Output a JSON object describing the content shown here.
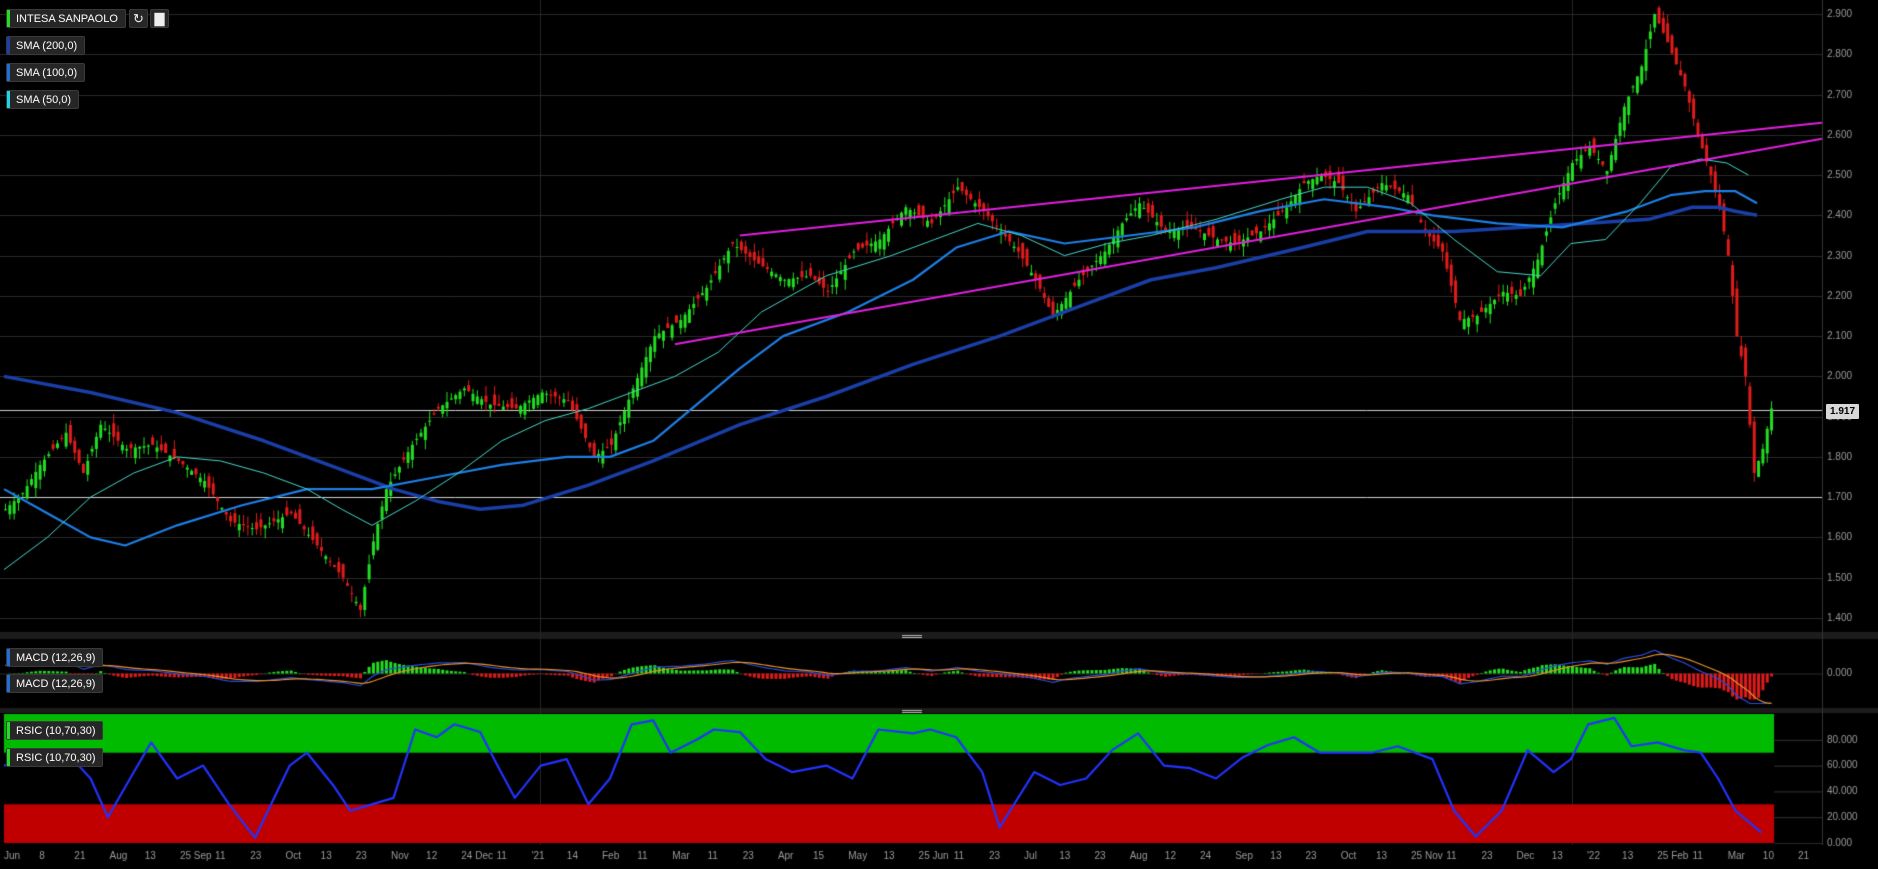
{
  "instrument": "INTESA SANPAOLO",
  "toolbar": {
    "refresh_icon": "refresh-icon",
    "settings_icon": "bar-chart-settings-icon"
  },
  "legends": {
    "sma200": "SMA (200,0)",
    "sma100": "SMA (100,0)",
    "sma50": "SMA (50,0)",
    "macd_a": "MACD (12,26,9)",
    "macd_b": "MACD (12,26,9)",
    "rsi_a": "RSIC (10,70,30)",
    "rsi_b": "RSIC (10,70,30)"
  },
  "colors": {
    "background": "#000000",
    "grid": "#2a2a2a",
    "candle_up": "#22dd22",
    "candle_down": "#e11b1b",
    "sma200": "#1a3fa8",
    "sma100": "#1e7fe6",
    "sma50": "#48d6c8",
    "trendline": "#e020e0",
    "macd_line": "#2a4bd6",
    "signal_line": "#e8902a",
    "rsi_line": "#2233ff",
    "rsi_overbought_zone": "#00bb00",
    "rsi_oversold_zone": "#c00000"
  },
  "chart_data": [
    {
      "type": "candlestick",
      "panel": "price",
      "title": "INTESA SANPAOLO",
      "last_price": 1.917,
      "last_price_label": "1.917",
      "ylim": [
        1.37,
        2.92
      ],
      "yticks": [
        "2.900",
        "2.800",
        "2.700",
        "2.600",
        "2.500",
        "2.400",
        "2.300",
        "2.200",
        "2.100",
        "2.000",
        "1.900",
        "1.800",
        "1.700",
        "1.600",
        "1.500",
        "1.400"
      ],
      "xticks": [
        "Jun",
        "8",
        "21",
        "Aug",
        "13",
        "25 Sep",
        "11",
        "23",
        "Oct",
        "13",
        "23",
        "Nov",
        "12",
        "24 Dec",
        "11",
        "'21",
        "14",
        "Feb",
        "11",
        "Mar",
        "11",
        "23",
        "Apr",
        "15",
        "May",
        "13",
        "25 Jun",
        "11",
        "23",
        "Jul",
        "13",
        "23",
        "Aug",
        "12",
        "24",
        "Sep",
        "13",
        "23",
        "Oct",
        "13",
        "25 Nov",
        "11",
        "23",
        "Dec",
        "13",
        "'22",
        "13",
        "25 Feb",
        "11",
        "Mar",
        "10",
        "21"
      ],
      "horizontal_lines": [
        1.917,
        1.7
      ],
      "price_path": [
        [
          0,
          1.67
        ],
        [
          4,
          1.71
        ],
        [
          8,
          1.78
        ],
        [
          14,
          1.86
        ],
        [
          18,
          1.76
        ],
        [
          22,
          1.88
        ],
        [
          28,
          1.82
        ],
        [
          34,
          1.83
        ],
        [
          40,
          1.79
        ],
        [
          46,
          1.74
        ],
        [
          52,
          1.64
        ],
        [
          58,
          1.62
        ],
        [
          66,
          1.66
        ],
        [
          72,
          1.58
        ],
        [
          78,
          1.5
        ],
        [
          82,
          1.42
        ],
        [
          85,
          1.59
        ],
        [
          88,
          1.72
        ],
        [
          94,
          1.83
        ],
        [
          100,
          1.92
        ],
        [
          106,
          1.97
        ],
        [
          112,
          1.93
        ],
        [
          118,
          1.92
        ],
        [
          124,
          1.96
        ],
        [
          130,
          1.94
        ],
        [
          136,
          1.8
        ],
        [
          140,
          1.83
        ],
        [
          145,
          1.97
        ],
        [
          150,
          2.1
        ],
        [
          156,
          2.14
        ],
        [
          162,
          2.22
        ],
        [
          168,
          2.33
        ],
        [
          174,
          2.28
        ],
        [
          180,
          2.24
        ],
        [
          186,
          2.25
        ],
        [
          190,
          2.21
        ],
        [
          196,
          2.31
        ],
        [
          202,
          2.34
        ],
        [
          208,
          2.42
        ],
        [
          214,
          2.38
        ],
        [
          220,
          2.47
        ],
        [
          226,
          2.41
        ],
        [
          230,
          2.36
        ],
        [
          234,
          2.31
        ],
        [
          238,
          2.24
        ],
        [
          242,
          2.15
        ],
        [
          248,
          2.24
        ],
        [
          254,
          2.31
        ],
        [
          258,
          2.38
        ],
        [
          262,
          2.43
        ],
        [
          268,
          2.36
        ],
        [
          274,
          2.37
        ],
        [
          280,
          2.34
        ],
        [
          284,
          2.33
        ],
        [
          290,
          2.36
        ],
        [
          296,
          2.42
        ],
        [
          300,
          2.48
        ],
        [
          304,
          2.5
        ],
        [
          308,
          2.48
        ],
        [
          312,
          2.41
        ],
        [
          318,
          2.48
        ],
        [
          324,
          2.45
        ],
        [
          328,
          2.36
        ],
        [
          332,
          2.31
        ],
        [
          336,
          2.14
        ],
        [
          340,
          2.15
        ],
        [
          346,
          2.21
        ],
        [
          350,
          2.2
        ],
        [
          354,
          2.29
        ],
        [
          358,
          2.43
        ],
        [
          362,
          2.53
        ],
        [
          366,
          2.57
        ],
        [
          370,
          2.51
        ],
        [
          374,
          2.67
        ],
        [
          378,
          2.77
        ],
        [
          381,
          2.9
        ],
        [
          384,
          2.83
        ],
        [
          388,
          2.72
        ],
        [
          391,
          2.6
        ],
        [
          394,
          2.5
        ],
        [
          396,
          2.42
        ],
        [
          398,
          2.3
        ],
        [
          400,
          2.1
        ],
        [
          402,
          2.0
        ],
        [
          404,
          1.76
        ],
        [
          406,
          1.82
        ],
        [
          408,
          1.92
        ]
      ],
      "sma200_path": [
        [
          0,
          2.0
        ],
        [
          20,
          1.96
        ],
        [
          40,
          1.91
        ],
        [
          60,
          1.84
        ],
        [
          75,
          1.78
        ],
        [
          90,
          1.72
        ],
        [
          100,
          1.69
        ],
        [
          110,
          1.67
        ],
        [
          120,
          1.68
        ],
        [
          135,
          1.73
        ],
        [
          150,
          1.79
        ],
        [
          170,
          1.88
        ],
        [
          190,
          1.95
        ],
        [
          210,
          2.03
        ],
        [
          230,
          2.1
        ],
        [
          250,
          2.18
        ],
        [
          265,
          2.24
        ],
        [
          280,
          2.27
        ],
        [
          300,
          2.32
        ],
        [
          315,
          2.36
        ],
        [
          335,
          2.36
        ],
        [
          350,
          2.37
        ],
        [
          365,
          2.38
        ],
        [
          380,
          2.39
        ],
        [
          390,
          2.42
        ],
        [
          396,
          2.42
        ],
        [
          400,
          2.41
        ],
        [
          405,
          2.4
        ]
      ],
      "sma100_path": [
        [
          0,
          1.72
        ],
        [
          10,
          1.66
        ],
        [
          20,
          1.6
        ],
        [
          28,
          1.58
        ],
        [
          40,
          1.63
        ],
        [
          55,
          1.68
        ],
        [
          70,
          1.72
        ],
        [
          85,
          1.72
        ],
        [
          100,
          1.75
        ],
        [
          115,
          1.78
        ],
        [
          130,
          1.8
        ],
        [
          140,
          1.8
        ],
        [
          150,
          1.84
        ],
        [
          160,
          1.93
        ],
        [
          170,
          2.02
        ],
        [
          180,
          2.1
        ],
        [
          195,
          2.16
        ],
        [
          210,
          2.24
        ],
        [
          220,
          2.32
        ],
        [
          232,
          2.36
        ],
        [
          245,
          2.33
        ],
        [
          260,
          2.35
        ],
        [
          275,
          2.37
        ],
        [
          290,
          2.41
        ],
        [
          305,
          2.44
        ],
        [
          320,
          2.42
        ],
        [
          330,
          2.4
        ],
        [
          345,
          2.38
        ],
        [
          360,
          2.37
        ],
        [
          375,
          2.41
        ],
        [
          385,
          2.45
        ],
        [
          393,
          2.46
        ],
        [
          400,
          2.46
        ],
        [
          405,
          2.43
        ]
      ],
      "sma50_path": [
        [
          0,
          1.52
        ],
        [
          10,
          1.6
        ],
        [
          20,
          1.7
        ],
        [
          30,
          1.76
        ],
        [
          40,
          1.8
        ],
        [
          50,
          1.79
        ],
        [
          60,
          1.76
        ],
        [
          70,
          1.72
        ],
        [
          78,
          1.67
        ],
        [
          85,
          1.63
        ],
        [
          95,
          1.69
        ],
        [
          105,
          1.76
        ],
        [
          115,
          1.84
        ],
        [
          125,
          1.89
        ],
        [
          135,
          1.92
        ],
        [
          145,
          1.96
        ],
        [
          155,
          2.0
        ],
        [
          165,
          2.06
        ],
        [
          175,
          2.16
        ],
        [
          190,
          2.25
        ],
        [
          205,
          2.3
        ],
        [
          215,
          2.34
        ],
        [
          225,
          2.38
        ],
        [
          235,
          2.35
        ],
        [
          245,
          2.3
        ],
        [
          255,
          2.33
        ],
        [
          265,
          2.35
        ],
        [
          280,
          2.39
        ],
        [
          295,
          2.44
        ],
        [
          305,
          2.47
        ],
        [
          315,
          2.47
        ],
        [
          325,
          2.43
        ],
        [
          335,
          2.34
        ],
        [
          345,
          2.26
        ],
        [
          355,
          2.25
        ],
        [
          362,
          2.33
        ],
        [
          370,
          2.34
        ],
        [
          378,
          2.43
        ],
        [
          385,
          2.52
        ],
        [
          392,
          2.54
        ],
        [
          398,
          2.53
        ],
        [
          403,
          2.5
        ]
      ],
      "trendlines": [
        {
          "from": [
            155,
            2.08
          ],
          "to": [
            420,
            2.59
          ]
        },
        {
          "from": [
            170,
            2.35
          ],
          "to": [
            420,
            2.63
          ]
        }
      ]
    },
    {
      "type": "macd",
      "panel": "macd",
      "ytick": "0.000"
    },
    {
      "type": "line",
      "panel": "rsi",
      "ylim": [
        0,
        100
      ],
      "overbought": 70,
      "oversold": 30,
      "yticks": [
        "80.000",
        "60.000",
        "40.000",
        "20.000",
        "0.000"
      ],
      "rsi_path": [
        [
          0,
          60
        ],
        [
          8,
          68
        ],
        [
          14,
          72
        ],
        [
          20,
          50
        ],
        [
          24,
          20
        ],
        [
          30,
          55
        ],
        [
          34,
          78
        ],
        [
          40,
          50
        ],
        [
          46,
          60
        ],
        [
          52,
          30
        ],
        [
          58,
          4
        ],
        [
          66,
          60
        ],
        [
          70,
          70
        ],
        [
          76,
          45
        ],
        [
          80,
          25
        ],
        [
          90,
          35
        ],
        [
          95,
          88
        ],
        [
          100,
          82
        ],
        [
          104,
          92
        ],
        [
          110,
          86
        ],
        [
          114,
          60
        ],
        [
          118,
          35
        ],
        [
          124,
          60
        ],
        [
          130,
          65
        ],
        [
          135,
          30
        ],
        [
          140,
          50
        ],
        [
          145,
          92
        ],
        [
          150,
          95
        ],
        [
          154,
          70
        ],
        [
          160,
          80
        ],
        [
          164,
          88
        ],
        [
          170,
          86
        ],
        [
          176,
          65
        ],
        [
          182,
          55
        ],
        [
          190,
          60
        ],
        [
          196,
          50
        ],
        [
          202,
          88
        ],
        [
          210,
          85
        ],
        [
          214,
          88
        ],
        [
          220,
          82
        ],
        [
          226,
          55
        ],
        [
          230,
          12
        ],
        [
          238,
          55
        ],
        [
          244,
          45
        ],
        [
          250,
          50
        ],
        [
          256,
          72
        ],
        [
          262,
          85
        ],
        [
          268,
          60
        ],
        [
          274,
          58
        ],
        [
          280,
          50
        ],
        [
          286,
          66
        ],
        [
          292,
          76
        ],
        [
          298,
          82
        ],
        [
          304,
          70
        ],
        [
          310,
          70
        ],
        [
          316,
          70
        ],
        [
          322,
          75
        ],
        [
          330,
          65
        ],
        [
          335,
          25
        ],
        [
          340,
          5
        ],
        [
          346,
          25
        ],
        [
          352,
          72
        ],
        [
          358,
          55
        ],
        [
          362,
          65
        ],
        [
          366,
          92
        ],
        [
          372,
          97
        ],
        [
          376,
          75
        ],
        [
          382,
          78
        ],
        [
          388,
          72
        ],
        [
          392,
          70
        ],
        [
          396,
          50
        ],
        [
          400,
          25
        ],
        [
          406,
          8
        ]
      ]
    }
  ]
}
